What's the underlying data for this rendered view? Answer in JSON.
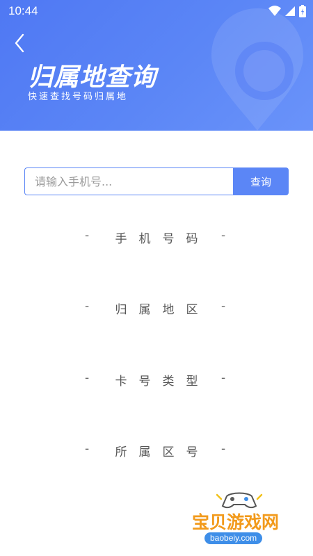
{
  "status_bar": {
    "time": "10:44"
  },
  "header": {
    "back_icon": "chevron-left-icon",
    "title": "归属地查询",
    "subtitle": "快速查找号码归属地"
  },
  "search": {
    "placeholder": "请输入手机号...",
    "value": "",
    "button_label": "查询"
  },
  "results": [
    {
      "label": "手机号码",
      "prefix": "-",
      "suffix": "-"
    },
    {
      "label": "归属地区",
      "prefix": "-",
      "suffix": "-"
    },
    {
      "label": "卡号类型",
      "prefix": "-",
      "suffix": "-"
    },
    {
      "label": "所属区号",
      "prefix": "-",
      "suffix": "-"
    }
  ],
  "watermark": {
    "text": "宝贝游戏网",
    "url": "baobeiy.com"
  },
  "colors": {
    "accent": "#5b86f6",
    "banner_start": "#4f78f3",
    "watermark_orange": "#f29a1b",
    "watermark_blue": "#3e8ee8"
  }
}
